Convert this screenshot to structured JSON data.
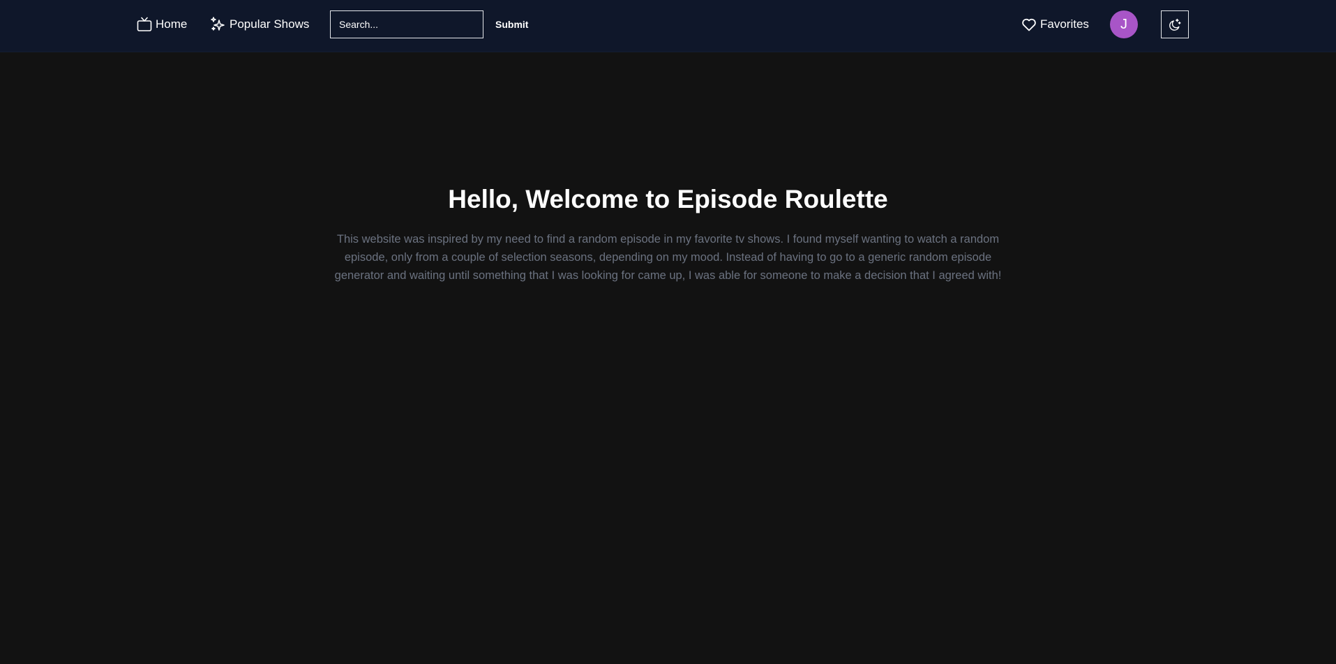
{
  "nav": {
    "home_label": "Home",
    "popular_label": "Popular Shows",
    "search_placeholder": "Search...",
    "search_value": "",
    "submit_label": "Submit",
    "favorites_label": "Favorites",
    "avatar_initial": "J",
    "icons": {
      "home": "tv-icon",
      "popular": "sparkles-icon",
      "favorites": "heart-icon",
      "theme": "moon-stars-icon"
    }
  },
  "hero": {
    "title": "Hello, Welcome to Episode Roulette",
    "description": "This website was inspired by my need to find a random episode in my favorite tv shows. I found myself wanting to watch a random episode, only from a couple of selection seasons, depending on my mood. Instead of having to go to a generic random episode generator and waiting until something that I was looking for came up, I was able for someone to make a decision that I agreed with!"
  },
  "colors": {
    "page_background": "#121212",
    "navbar_background": "#0f172a",
    "avatar_background": "#a855c7",
    "body_text": "#6b7280",
    "heading_text": "#ffffff"
  }
}
